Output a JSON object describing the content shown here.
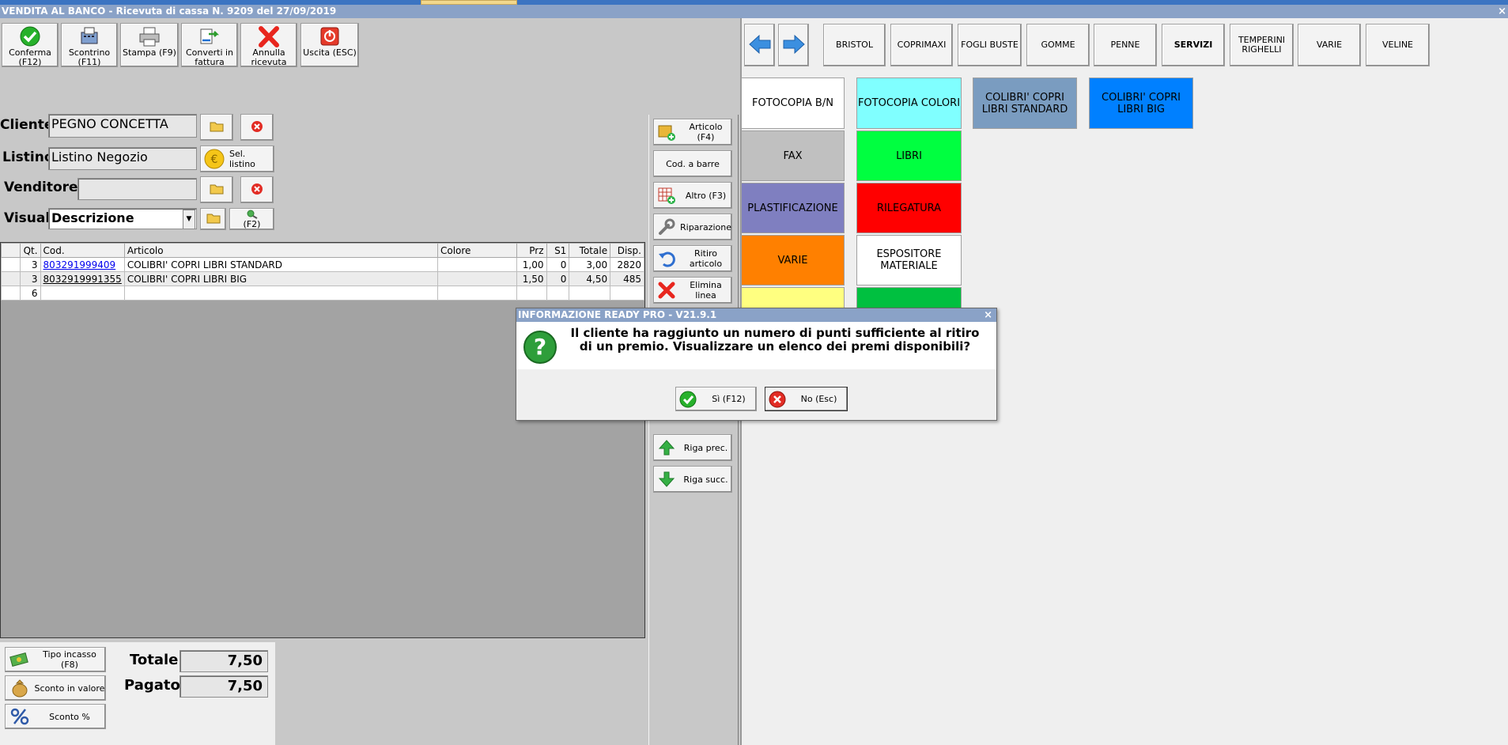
{
  "window": {
    "title": "VENDITA AL BANCO - Ricevuta di cassa N. 9209 del 27/09/2019",
    "close_glyph": "×"
  },
  "toolbar": [
    {
      "name": "confirm-button",
      "label": "Conferma (F12)",
      "icon": "check-circle-icon"
    },
    {
      "name": "receipt-button",
      "label": "Scontrino (F11)",
      "icon": "cash-register-icon"
    },
    {
      "name": "print-button",
      "label": "Stampa (F9)",
      "icon": "printer-icon"
    },
    {
      "name": "convert-invoice-button",
      "label": "Converti in fattura",
      "icon": "convert-icon"
    },
    {
      "name": "cancel-receipt-button",
      "label": "Annulla ricevuta",
      "icon": "red-x-icon"
    },
    {
      "name": "exit-button",
      "label": "Uscita (ESC)",
      "icon": "power-icon"
    }
  ],
  "form": {
    "cliente_label": "Cliente",
    "cliente_value": "PEGNO CONCETTA",
    "listino_label": "Listino",
    "listino_value": "Listino Negozio",
    "sel_listino_label": "Sel. listino",
    "venditore_label": "Venditore",
    "venditore_value": "",
    "visual_label": "Visual.",
    "visual_value": "Descrizione",
    "f2_label": "(F2)"
  },
  "table": {
    "columns": [
      "",
      "Qt.",
      "Cod.",
      "Articolo",
      "Colore",
      "Prz",
      "S1",
      "Totale",
      "Disp."
    ],
    "rows": [
      {
        "qt": "3",
        "cod": "803291999409",
        "articolo": "COLIBRI' COPRI LIBRI STANDARD",
        "colore": "",
        "prz": "1,00",
        "s1": "0",
        "totale": "3,00",
        "disp": "2820"
      },
      {
        "qt": "3",
        "cod": "8032919991355",
        "articolo": "COLIBRI' COPRI LIBRI BIG",
        "colore": "",
        "prz": "1,50",
        "s1": "0",
        "totale": "4,50",
        "disp": "485"
      },
      {
        "qt": "6",
        "cod": "",
        "articolo": "",
        "colore": "",
        "prz": "",
        "s1": "",
        "totale": "",
        "disp": ""
      }
    ]
  },
  "side_buttons": [
    {
      "name": "article-button",
      "label": "Articolo (F4)",
      "icon": "box-add-icon"
    },
    {
      "name": "barcode-button",
      "label": "Cod. a barre",
      "icon": ""
    },
    {
      "name": "other-button",
      "label": "Altro (F3)",
      "icon": "grid-add-icon"
    },
    {
      "name": "repair-button",
      "label": "Riparazione",
      "icon": "wrench-icon"
    },
    {
      "name": "return-article-button",
      "label": "Ritiro articolo",
      "icon": "undo-icon"
    },
    {
      "name": "delete-line-button",
      "label": "Elimina linea",
      "icon": "red-x-icon"
    },
    {
      "name": "prev-row-button",
      "label": "Riga prec.",
      "icon": "arrow-up-icon"
    },
    {
      "name": "next-row-button",
      "label": "Riga succ.",
      "icon": "arrow-down-icon"
    }
  ],
  "bottom": {
    "tipo_incasso": "Tipo incasso (F8)",
    "sconto_valore": "Sconto in valore",
    "sconto_perc": "Sconto %",
    "totale_label": "Totale",
    "totale_value": "7,50",
    "pagato_label": "Pagato",
    "pagato_value": "7,50"
  },
  "categories_top": [
    "BRISTOL",
    "COPRIMAXI",
    "FOGLI BUSTE",
    "GOMME",
    "PENNE",
    "SERVIZI",
    "TEMPERINI RIGHELLI",
    "VARIE",
    "VELINE"
  ],
  "products": {
    "col1": [
      {
        "label": "FOTOCOPIA B/N",
        "color": "#ffffff",
        "text": "#000000"
      },
      {
        "label": "FAX",
        "color": "#c0c0c0",
        "text": "#000000"
      },
      {
        "label": "PLASTIFICAZIONE",
        "color": "#7f7fc0",
        "text": "#000000"
      },
      {
        "label": "VARIE",
        "color": "#ff8000",
        "text": "#000000"
      },
      {
        "label": "",
        "color": "#ffff80",
        "text": "#000000"
      }
    ],
    "col2": [
      {
        "label": "FOTOCOPIA COLORI",
        "color": "#80ffff",
        "text": "#000000"
      },
      {
        "label": "LIBRI",
        "color": "#00ff40",
        "text": "#000000"
      },
      {
        "label": "RILEGATURA",
        "color": "#ff0000",
        "text": "#000000"
      },
      {
        "label": "ESPOSITORE MATERIALE",
        "color": "#ffffff",
        "text": "#000000"
      },
      {
        "label": "",
        "color": "#00c040",
        "text": "#000000"
      }
    ],
    "col3": [
      {
        "label": "COLIBRI' COPRI LIBRI STANDARD",
        "color": "#7a9cc0",
        "text": "#000000"
      }
    ],
    "col4": [
      {
        "label": "COLIBRI' COPRI LIBRI BIG",
        "color": "#0080ff",
        "text": "#000000"
      }
    ]
  },
  "dialog": {
    "title": "INFORMAZIONE READY PRO - V21.9.1",
    "close": "×",
    "message": "Il cliente ha raggiunto un numero di punti sufficiente al ritiro di un premio. Visualizzare un elenco dei premi disponibili?",
    "yes_label": "Sì (F12)",
    "no_label": "No (Esc)"
  }
}
